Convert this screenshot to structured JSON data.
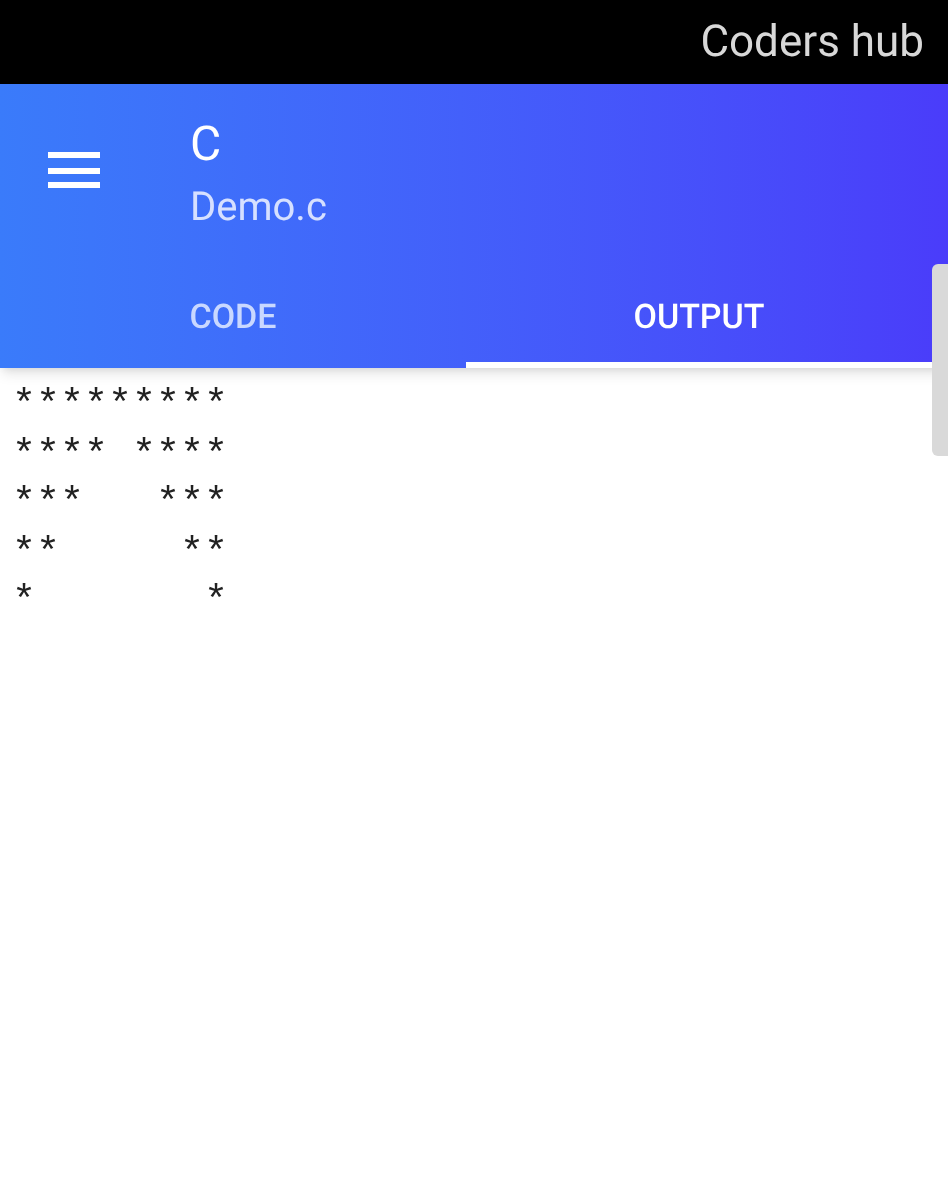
{
  "status_bar": {
    "title": "Coders hub"
  },
  "app_bar": {
    "title": "C",
    "subtitle": "Demo.c"
  },
  "tabs": [
    {
      "label": "CODE",
      "selected": false
    },
    {
      "label": "OUTPUT",
      "selected": true
    }
  ],
  "output": [
    [
      "*********"
    ],
    [
      "****",
      "****"
    ],
    [
      "***",
      "***"
    ],
    [
      "**",
      "**"
    ],
    [
      "*",
      "*"
    ]
  ]
}
